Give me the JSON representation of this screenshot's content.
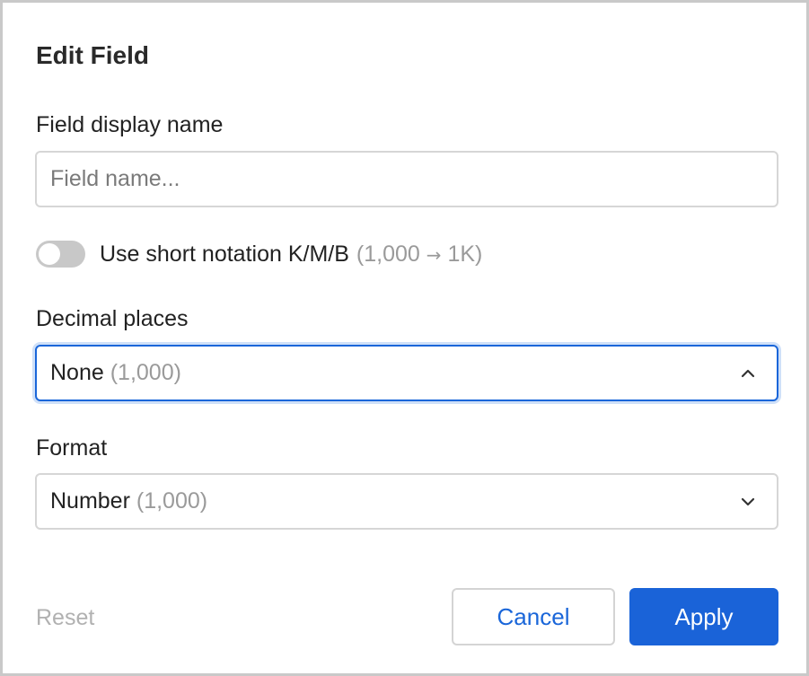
{
  "dialog": {
    "title": "Edit Field"
  },
  "display_name": {
    "label": "Field display name",
    "placeholder": "Field name...",
    "value": ""
  },
  "short_notation": {
    "enabled": false,
    "label": "Use short notation K/M/B",
    "hint_open": "(1,000",
    "hint_arrow": "→",
    "hint_close": "1K)"
  },
  "decimal_places": {
    "label": "Decimal places",
    "selected": "None",
    "example": "(1,000)",
    "expanded": true
  },
  "format": {
    "label": "Format",
    "selected": "Number",
    "example": "(1,000)",
    "expanded": false
  },
  "footer": {
    "reset_label": "Reset",
    "cancel_label": "Cancel",
    "apply_label": "Apply"
  },
  "colors": {
    "primary": "#1a63d8",
    "focus_ring": "#cfe0f8",
    "toggle_off": "#c8c8c8",
    "disabled_text": "#b1b1b1"
  },
  "icons": {
    "decimal_chevron": "chevron-up-icon",
    "format_chevron": "chevron-down-icon",
    "hint_arrow": "arrow-right-icon"
  }
}
